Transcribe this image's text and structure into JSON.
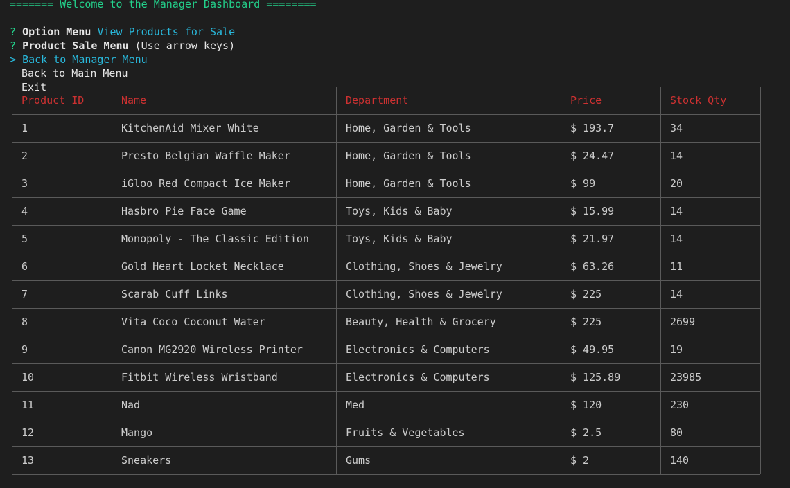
{
  "banner": "======= Welcome to the Manager Dashboard ========",
  "prompts": [
    {
      "mark": "?",
      "label": "Option Menu",
      "answer": "View Products for Sale"
    },
    {
      "mark": "?",
      "label": "Product Sale Menu",
      "hint": "(Use arrow keys)"
    }
  ],
  "menu": {
    "pointer": ">",
    "selected": "Back to Manager Menu",
    "items": [
      "Back to Main Menu",
      "Exit"
    ]
  },
  "table": {
    "headers": [
      "Product ID",
      "Name",
      "Department",
      "Price",
      "Stock Qty"
    ],
    "rows": [
      [
        "1",
        "KitchenAid Mixer White",
        "Home, Garden & Tools",
        "$ 193.7",
        "34"
      ],
      [
        "2",
        "Presto Belgian Waffle Maker",
        "Home, Garden & Tools",
        "$ 24.47",
        "14"
      ],
      [
        "3",
        "iGloo Red Compact Ice Maker",
        "Home, Garden & Tools",
        "$ 99",
        "20"
      ],
      [
        "4",
        "Hasbro Pie Face Game",
        "Toys, Kids & Baby",
        "$ 15.99",
        "14"
      ],
      [
        "5",
        "Monopoly - The Classic Edition",
        "Toys, Kids & Baby",
        "$ 21.97",
        "14"
      ],
      [
        "6",
        "Gold Heart Locket Necklace",
        "Clothing, Shoes & Jewelry",
        "$ 63.26",
        "11"
      ],
      [
        "7",
        "Scarab Cuff Links",
        "Clothing, Shoes & Jewelry",
        "$ 225",
        "14"
      ],
      [
        "8",
        "Vita Coco Coconut Water",
        "Beauty, Health & Grocery",
        "$ 225",
        "2699"
      ],
      [
        "9",
        "Canon MG2920 Wireless Printer",
        "Electronics & Computers",
        "$ 49.95",
        "19"
      ],
      [
        "10",
        "Fitbit Wireless Wristband",
        "Electronics & Computers",
        "$ 125.89",
        "23985"
      ],
      [
        "11",
        "Nad",
        "Med",
        "$ 120",
        "230"
      ],
      [
        "12",
        "Mango",
        "Fruits & Vegetables",
        "$ 2.5",
        "80"
      ],
      [
        "13",
        "Sneakers",
        "Gums",
        "$ 2",
        "140"
      ]
    ]
  },
  "colors": {
    "background": "#1e1e1e",
    "prompt_mark": "#23d18b",
    "answer": "#29b8db",
    "header": "#cd3131",
    "text": "#cccccc"
  }
}
